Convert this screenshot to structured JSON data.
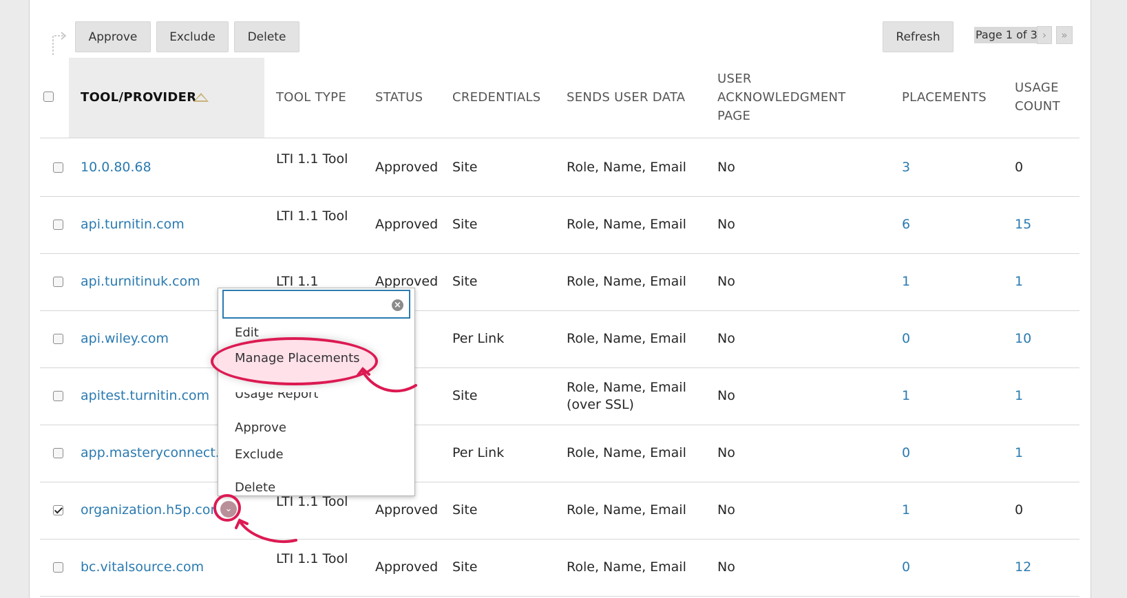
{
  "toolbar": {
    "approve_label": "Approve",
    "exclude_label": "Exclude",
    "delete_label": "Delete",
    "refresh_label": "Refresh"
  },
  "pager": {
    "text": "Page 1 of 3",
    "next_icon": "chevron-right-icon",
    "last_icon": "double-chevron-right-icon"
  },
  "table": {
    "columns": [
      {
        "label": "TOOL/PROVIDER"
      },
      {
        "label": "TOOL TYPE"
      },
      {
        "label": "STATUS"
      },
      {
        "label": "CREDENTIALS"
      },
      {
        "label": "SENDS USER DATA"
      },
      {
        "label": "USER ACKNOWLEDGMENT PAGE"
      },
      {
        "label": "PLACEMENTS"
      },
      {
        "label": "USAGE COUNT"
      }
    ],
    "sort": {
      "column": "TOOL/PROVIDER",
      "direction": "ascending"
    },
    "rows": [
      {
        "checked": false,
        "provider": "10.0.80.68",
        "type": "LTI 1.1 Tool",
        "status": "Approved",
        "credentials": "Site",
        "sends": "Role, Name, Email",
        "ack": "No",
        "placements": "3",
        "usage": "0"
      },
      {
        "checked": false,
        "provider": "api.turnitin.com",
        "type": "LTI 1.1 Tool",
        "status": "Approved",
        "credentials": "Site",
        "sends": "Role, Name, Email",
        "ack": "No",
        "placements": "6",
        "usage": "15"
      },
      {
        "checked": false,
        "provider": "api.turnitinuk.com",
        "type": "LTI 1.1",
        "status": "Approved",
        "credentials": "Site",
        "sends": "Role, Name, Email",
        "ack": "No",
        "placements": "1",
        "usage": "1"
      },
      {
        "checked": false,
        "provider": "api.wiley.com",
        "type": "",
        "status": "ved",
        "credentials": "Per Link",
        "sends": "Role, Name, Email",
        "ack": "No",
        "placements": "0",
        "usage": "10"
      },
      {
        "checked": false,
        "provider": "apitest.turnitin.com",
        "type": "",
        "status": "ved",
        "credentials": "Site",
        "sends": "Role, Name, Email (over SSL)",
        "ack": "No",
        "placements": "1",
        "usage": "1"
      },
      {
        "checked": false,
        "provider": "app.masteryconnect.c",
        "type": "",
        "status": "ved",
        "credentials": "Per Link",
        "sends": "Role, Name, Email",
        "ack": "No",
        "placements": "0",
        "usage": "1"
      },
      {
        "checked": true,
        "provider": "organization.h5p.cor",
        "type": "LTI 1.1 Tool",
        "status": "Approved",
        "credentials": "Site",
        "sends": "Role, Name, Email",
        "ack": "No",
        "placements": "1",
        "usage": "0"
      },
      {
        "checked": false,
        "provider": "bc.vitalsource.com",
        "type": "LTI 1.1 Tool",
        "status": "Approved",
        "credentials": "Site",
        "sends": "Role, Name, Email",
        "ack": "No",
        "placements": "0",
        "usage": "12"
      }
    ]
  },
  "context_menu": {
    "search_value": "",
    "clear_icon": "clear-circle-icon",
    "items": [
      "Edit",
      "Manage Placements",
      "Usage Report",
      "Approve",
      "Exclude",
      "Delete"
    ],
    "highlighted": "Manage Placements"
  },
  "colors": {
    "link": "#2a7ab0",
    "annotation": "#dc1a52",
    "button_bg": "#e3e3e3",
    "header_sorted_bg": "#ececec"
  }
}
